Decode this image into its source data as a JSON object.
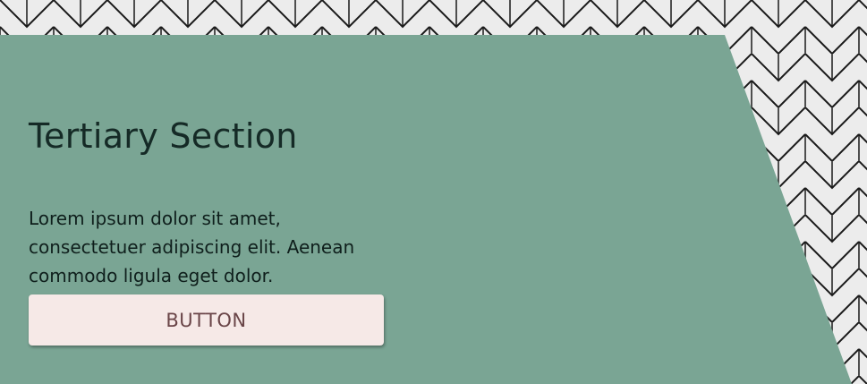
{
  "section": {
    "title": "Tertiary Section",
    "body": "Lorem ipsum dolor sit amet, consectetuer adipiscing elit. Aenean commodo ligula eget dolor.",
    "button_label": "BUTTON"
  },
  "colors": {
    "panel": "#7aa594",
    "button_bg": "#f6e9e7",
    "button_text": "#6a4548",
    "tile": "#f2f2f2",
    "grout": "#1a1a1a"
  }
}
